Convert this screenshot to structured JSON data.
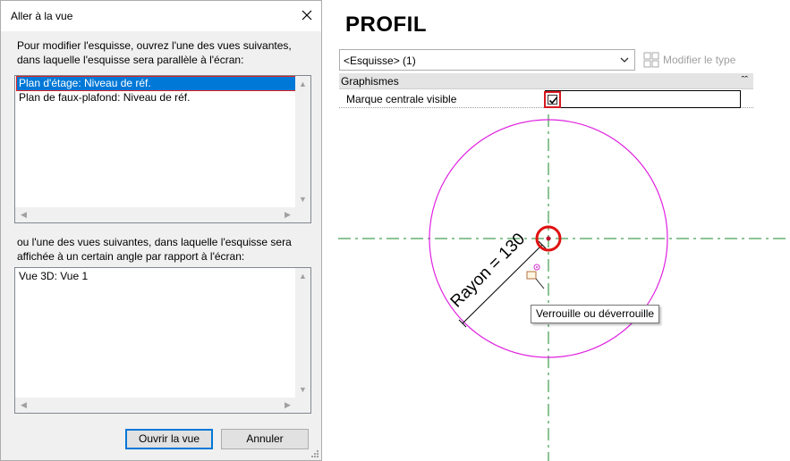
{
  "dialog": {
    "title": "Aller à la vue",
    "instruction_1_line1": "Pour modifier l'esquisse, ouvrez l'une des vues suivantes,",
    "instruction_1_line2": "dans laquelle l'esquisse sera parallèle à l'écran:",
    "list1_items": [
      "Plan d'étage: Niveau de réf.",
      "Plan de faux-plafond: Niveau de réf."
    ],
    "instruction_2_line1": "ou l'une des vues suivantes, dans laquelle l'esquisse sera",
    "instruction_2_line2": "affichée à un certain angle par rapport à l'écran:",
    "list2_items": [
      "Vue 3D: Vue 1"
    ],
    "ok_button": "Ouvrir la vue",
    "cancel_button": "Annuler"
  },
  "properties": {
    "heading": "PROFIL",
    "type_selector": "<Esquisse> (1)",
    "modify_type_label": "Modifier le type",
    "group_label": "Graphismes",
    "param_label": "Marque centrale visible",
    "param_checked": true
  },
  "sketch": {
    "dimension_label": "Rayon = 130",
    "tooltip": "Verrouille ou déverrouille",
    "circle_color": "#e020e0",
    "axis_color": "#1a8a2a",
    "highlight_color": "#e01010"
  }
}
